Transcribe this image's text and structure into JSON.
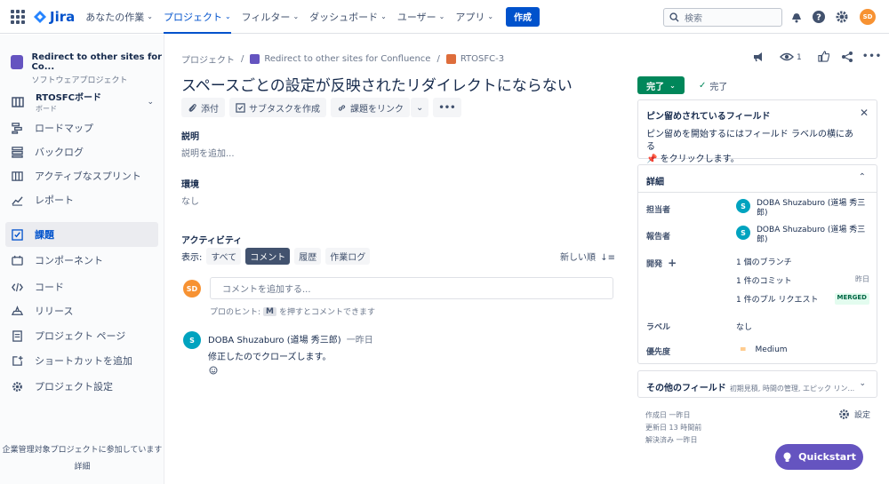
{
  "nav": {
    "logo": "Jira",
    "items": [
      {
        "label": "あなたの作業",
        "active": false
      },
      {
        "label": "プロジェクト",
        "active": true
      },
      {
        "label": "フィルター",
        "active": false
      },
      {
        "label": "ダッシュボード",
        "active": false
      },
      {
        "label": "ユーザー",
        "active": false
      },
      {
        "label": "アプリ",
        "active": false
      }
    ],
    "create_label": "作成",
    "search_placeholder": "検索",
    "avatar_initials": "SD",
    "avatar_color": "#f79232"
  },
  "sidebar": {
    "project_name": "Redirect to other sites for Co...",
    "project_type": "ソフトウェアプロジェクト",
    "board_title": "RTOSFCボード",
    "board_sub": "ボード",
    "items": [
      {
        "label": "ロードマップ",
        "icon": "roadmap-icon"
      },
      {
        "label": "バックログ",
        "icon": "backlog-icon"
      },
      {
        "label": "アクティブなスプリント",
        "icon": "sprint-icon"
      },
      {
        "label": "レポート",
        "icon": "report-icon"
      },
      {
        "label": "課題",
        "icon": "issues-icon"
      },
      {
        "label": "コンポーネント",
        "icon": "component-icon"
      },
      {
        "label": "コード",
        "icon": "code-icon"
      },
      {
        "label": "リリース",
        "icon": "release-icon"
      },
      {
        "label": "プロジェクト ページ",
        "icon": "page-icon"
      },
      {
        "label": "ショートカットを追加",
        "icon": "shortcut-icon"
      },
      {
        "label": "プロジェクト設定",
        "icon": "gear-icon"
      }
    ],
    "selected_index": 4,
    "footer_text": "企業管理対象プロジェクトに参加しています",
    "footer_link": "詳細"
  },
  "issue": {
    "breadcrumbs": [
      "プロジェクト",
      "Redirect to other sites for Confluence",
      "RTOSFC-3"
    ],
    "title": "スペースごとの設定が反映されたリダイレクトにならない",
    "actions": {
      "attach": "添付",
      "subtask": "サブタスクを作成",
      "link": "課題をリンク"
    },
    "description_heading": "説明",
    "description_placeholder": "説明を追加...",
    "environment_heading": "環境",
    "environment_value": "なし",
    "activity_heading": "アクティビティ",
    "show_label": "表示:",
    "filters": [
      "すべて",
      "コメント",
      "履歴",
      "作業ログ"
    ],
    "active_filter": 1,
    "sort_label": "新しい順",
    "comment_placeholder": "コメントを追加する...",
    "hint_prefix": "プロのヒント:",
    "hint_key": "M",
    "hint_suffix": "を押すとコメントできます",
    "comment": {
      "author": "DOBA Shuzaburo (道場 秀三郎)",
      "time": "一昨日",
      "body": "修正したのでクローズします。",
      "avatar_initial": "S"
    }
  },
  "right": {
    "watch_count": "1",
    "status": "完了",
    "resolution": "完了",
    "pin": {
      "title": "ピン留めされているフィールド",
      "body_1": "ピン留めを開始するにはフィールド ラベルの横にある",
      "body_2": "をクリックします。"
    },
    "details": {
      "title": "詳細",
      "assignee_label": "担当者",
      "assignee": "DOBA Shuzaburo (道場 秀三郎)",
      "reporter_label": "報告者",
      "reporter": "DOBA Shuzaburo (道場 秀三郎)",
      "dev_label": "開発",
      "branch": "1 個のブランチ",
      "commit": "1 件のコミット",
      "commit_time": "昨日",
      "pr": "1 件のプル リクエスト",
      "pr_status": "MERGED",
      "labels_label": "ラベル",
      "labels_value": "なし",
      "priority_label": "優先度",
      "priority_value": "Medium",
      "person_initial": "S"
    },
    "other": {
      "title": "その他のフィールド",
      "sub": "初期見積, 時間の管理, エピック リン..."
    },
    "created": "作成日 一昨日",
    "updated": "更新日 13 時間前",
    "resolved": "解決済み 一昨日",
    "settings_label": "設定",
    "quickstart": "Quickstart"
  }
}
